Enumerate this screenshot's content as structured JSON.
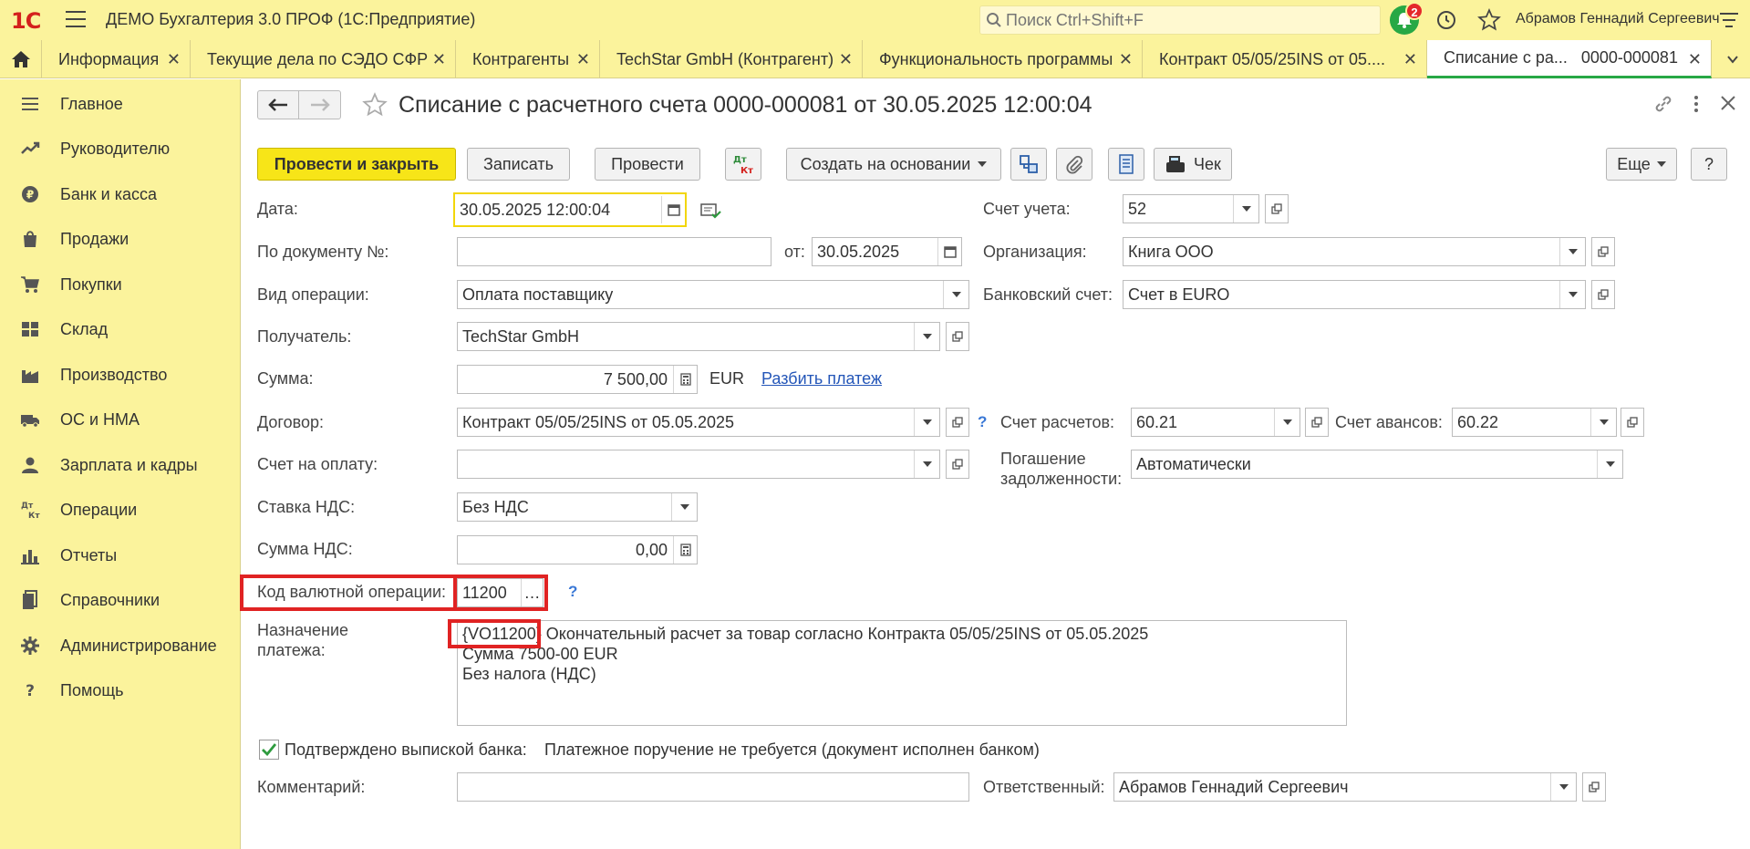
{
  "app": {
    "logo": "1С",
    "title": "ДЕМО Бухгалтерия 3.0 ПРОФ  (1С:Предприятие)",
    "search_placeholder": "Поиск Ctrl+Shift+F",
    "notifications_count": "2",
    "user": "Абрамов Геннадий Сергеевич"
  },
  "tabs": [
    {
      "label": "Информация"
    },
    {
      "label": "Текущие дела по СЭДО СФР"
    },
    {
      "label": "Контрагенты"
    },
    {
      "label": "TechStar GmbH (Контрагент)"
    },
    {
      "label": "Функциональность программы"
    },
    {
      "label": "Контракт 05/05/25INS от 05...."
    },
    {
      "label": "Списание с ра...   0000-000081"
    }
  ],
  "sidebar": {
    "items": [
      {
        "label": "Главное",
        "icon": "menu-icon"
      },
      {
        "label": "Руководителю",
        "icon": "trend-icon"
      },
      {
        "label": "Банк и касса",
        "icon": "coin-icon"
      },
      {
        "label": "Продажи",
        "icon": "bag-icon"
      },
      {
        "label": "Покупки",
        "icon": "cart-icon"
      },
      {
        "label": "Склад",
        "icon": "warehouse-icon"
      },
      {
        "label": "Производство",
        "icon": "factory-icon"
      },
      {
        "label": "ОС и НМА",
        "icon": "truck-icon"
      },
      {
        "label": "Зарплата и кадры",
        "icon": "person-icon"
      },
      {
        "label": "Операции",
        "icon": "dt-kt-icon"
      },
      {
        "label": "Отчеты",
        "icon": "bar-chart-icon"
      },
      {
        "label": "Справочники",
        "icon": "book-icon"
      },
      {
        "label": "Администрирование",
        "icon": "gear-icon"
      },
      {
        "label": "Помощь",
        "icon": "question-icon"
      }
    ]
  },
  "form": {
    "title": "Списание с расчетного счета 0000-000081 от 30.05.2025 12:00:04",
    "toolbar": {
      "post_close": "Провести и закрыть",
      "save": "Записать",
      "post": "Провести",
      "create_based": "Создать на основании",
      "check": "Чек",
      "more": "Еще",
      "help": "?"
    },
    "date_label": "Дата:",
    "date_value": "30.05.2025 12:00:04",
    "doc_num_label": "По документу №:",
    "doc_num_value": "",
    "doc_from_label": "от:",
    "doc_from_value": "30.05.2025",
    "operation_label": "Вид операции:",
    "operation_value": "Оплата поставщику",
    "recipient_label": "Получатель:",
    "recipient_value": "TechStar GmbH",
    "amount_label": "Сумма:",
    "amount_value": "7 500,00",
    "currency": "EUR",
    "split_link": "Разбить платеж",
    "contract_label": "Договор:",
    "contract_value": "Контракт 05/05/25INS от 05.05.2025",
    "invoice_label": "Счет на оплату:",
    "invoice_value": "",
    "vat_rate_label": "Ставка НДС:",
    "vat_rate_value": "Без НДС",
    "vat_sum_label": "Сумма НДС:",
    "vat_sum_value": "0,00",
    "currency_op_label": "Код валютной операции:",
    "currency_op_value": "11200",
    "purpose_label_1": "Назначение",
    "purpose_label_2": "платежа:",
    "purpose_code": "{VO11200}",
    "purpose_line1_rest": " Окончательный расчет за товар согласно Контракта 05/05/25INS от 05.05.2025",
    "purpose_line2": "Сумма 7500-00 EUR",
    "purpose_line3": "Без налога (НДС)",
    "confirmed_label": "Подтверждено выпиской банка:",
    "confirmed_checked": true,
    "confirmed_note": "Платежное поручение не требуется (документ исполнен банком)",
    "comment_label": "Комментарий:",
    "comment_value": "",
    "account_label": "Счет учета:",
    "account_value": "52",
    "org_label": "Организация:",
    "org_value": "Книга ООО",
    "bank_label": "Банковский счет:",
    "bank_value": "Счет в EURO",
    "settle_label": "Счет расчетов:",
    "settle_value": "60.21",
    "advance_label": "Счет авансов:",
    "advance_value": "60.22",
    "debt_label_1": "Погашение",
    "debt_label_2": "задолженности:",
    "debt_value": "Автоматически",
    "responsible_label": "Ответственный:",
    "responsible_value": "Абрамов Геннадий Сергеевич"
  },
  "colors": {
    "panel": "#fbf39c",
    "primary_button": "#f7e518",
    "active_tab_underline": "#27a845",
    "highlight": "#e02323",
    "link": "#2456b8"
  }
}
